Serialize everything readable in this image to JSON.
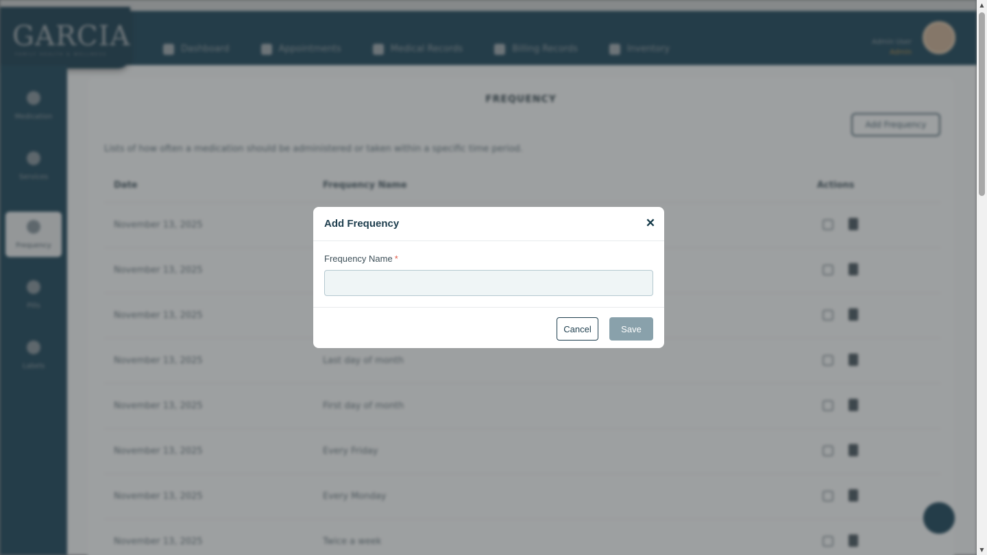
{
  "brand": {
    "logo_text": "GARCIA",
    "logo_sub": "FAMILY HEALTH & WELLNESS"
  },
  "topnav": [
    {
      "label": "Dashboard",
      "icon": "dashboard-icon"
    },
    {
      "label": "Appointments",
      "icon": "calendar-icon"
    },
    {
      "label": "Medical Records",
      "icon": "clipboard-icon"
    },
    {
      "label": "Billing Records",
      "icon": "billing-icon"
    },
    {
      "label": "Inventory",
      "icon": "inventory-icon"
    }
  ],
  "user": {
    "name": "Admin User",
    "role": "Admin"
  },
  "sidebar": [
    {
      "label": "Medication",
      "icon": "pill-icon",
      "active": false
    },
    {
      "label": "Services",
      "icon": "briefcase-icon",
      "active": false
    },
    {
      "label": "Frequency",
      "icon": "globe-icon",
      "active": true
    },
    {
      "label": "Pills",
      "icon": "pills-icon",
      "active": false
    },
    {
      "label": "Labels",
      "icon": "tag-icon",
      "active": false
    }
  ],
  "page": {
    "title": "FREQUENCY",
    "add_button": "Add Frequency",
    "description": "Lists of how often a medication should be administered or taken within a specific time period.",
    "columns": {
      "date": "Date",
      "name": "Frequency Name",
      "actions": "Actions"
    },
    "rows": [
      {
        "date": "November 13, 2025",
        "name": ""
      },
      {
        "date": "November 13, 2025",
        "name": ""
      },
      {
        "date": "November 13, 2025",
        "name": ""
      },
      {
        "date": "November 13, 2025",
        "name": "Last day of month"
      },
      {
        "date": "November 13, 2025",
        "name": "First day of month"
      },
      {
        "date": "November 13, 2025",
        "name": "Every Friday"
      },
      {
        "date": "November 13, 2025",
        "name": "Every Monday"
      },
      {
        "date": "November 13, 2025",
        "name": "Twice a week"
      }
    ]
  },
  "modal": {
    "title": "Add Frequency",
    "field_label": "Frequency Name",
    "required_mark": "*",
    "field_value": "",
    "field_placeholder": "",
    "cancel_label": "Cancel",
    "save_label": "Save",
    "close_glyph": "✕"
  },
  "colors": {
    "primary": "#0f3a4f",
    "required": "#e05a48",
    "save_disabled": "#89a1ab",
    "input_bg": "#eff5f6"
  }
}
